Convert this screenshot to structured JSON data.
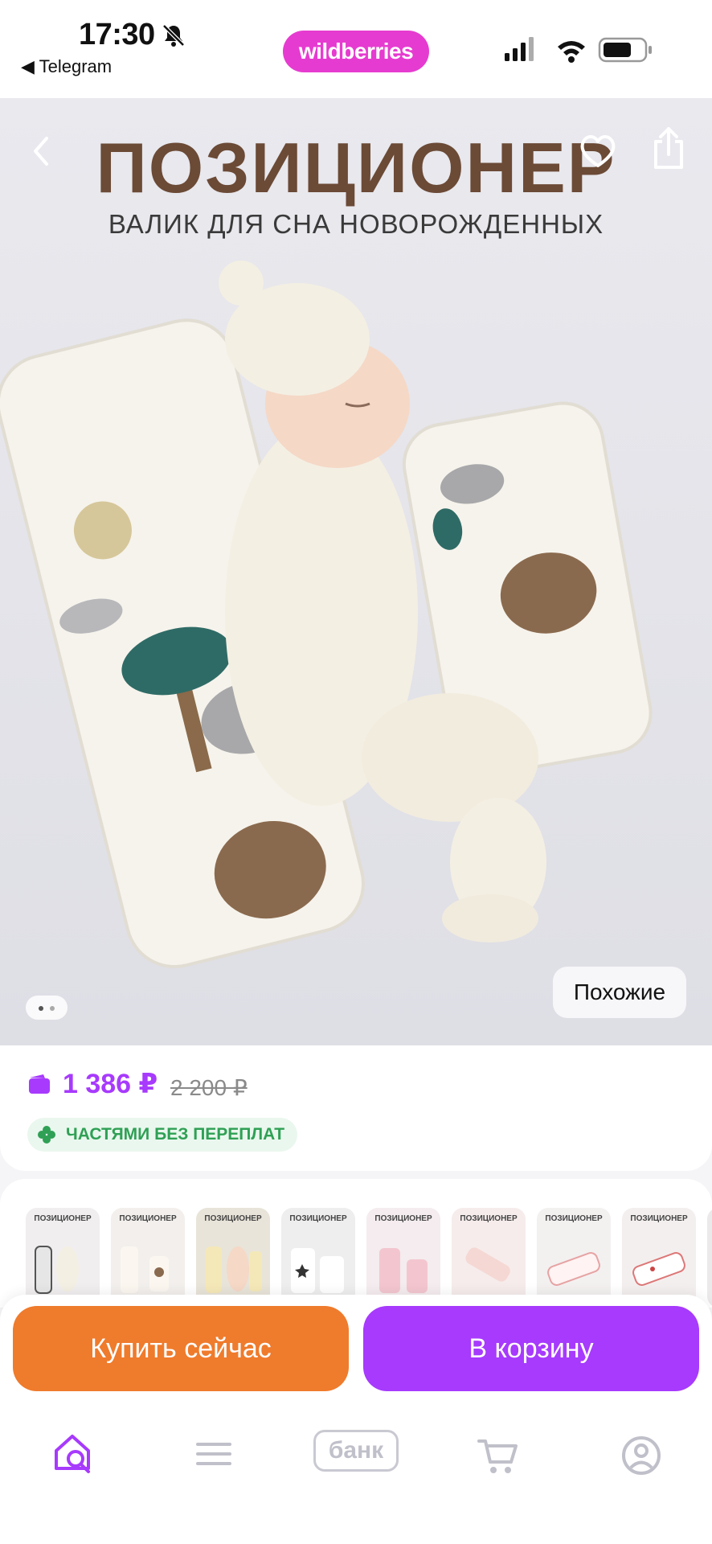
{
  "status_bar": {
    "time": "17:30",
    "back_app": "◀ Telegram",
    "brand": "wildberries"
  },
  "hero": {
    "title": "ПОЗИЦИОНЕР",
    "subtitle": "ВАЛИК ДЛЯ СНА НОВОРОЖДЕННЫХ",
    "similar_label": "Похожие",
    "page_count": 2,
    "current_page": 1
  },
  "price": {
    "current": "1 386 ₽",
    "old": "2 200 ₽",
    "installments_label": "ЧАСТЯМИ БЕЗ ПЕРЕПЛАТ",
    "accent_color": "#a73afd",
    "installments_color": "#2fa055"
  },
  "thumbnails": [
    {
      "label": "ПОЗИЦИОНЕР",
      "color": "#f0eeee"
    },
    {
      "label": "ПОЗИЦИОНЕР",
      "color": "#f2efec"
    },
    {
      "label": "ПОЗИЦИОНЕР",
      "color": "#e8e4d9"
    },
    {
      "label": "ПОЗИЦИОНЕР",
      "color": "#eeeeee"
    },
    {
      "label": "ПОЗИЦИОНЕР",
      "color": "#f4ecee"
    },
    {
      "label": "ПОЗИЦИОНЕР",
      "color": "#f6ecec"
    },
    {
      "label": "ПОЗИЦИОНЕР",
      "color": "#f3f0f0"
    },
    {
      "label": "ПОЗИЦИОНЕР",
      "color": "#f4efef"
    }
  ],
  "actions": {
    "buy_now": "Купить сейчас",
    "add_to_cart": "В корзину",
    "buy_color": "#ef7b2c",
    "cart_color": "#a73afd"
  },
  "tabbar": {
    "bank_label": "банк",
    "items": [
      "home-search-icon",
      "menu-icon",
      "bank-icon",
      "cart-icon",
      "profile-icon"
    ]
  }
}
